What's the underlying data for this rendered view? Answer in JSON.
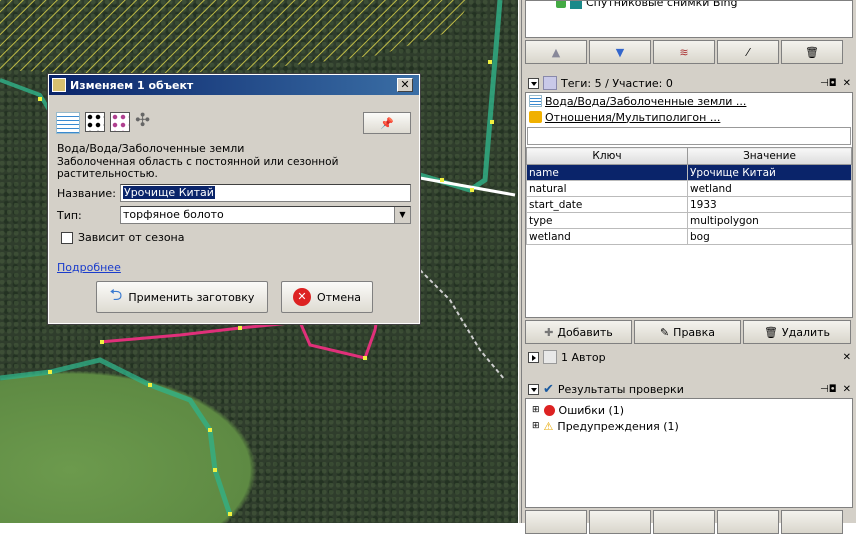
{
  "imagery": {
    "label": "Спутниковые снимки Bing"
  },
  "layer_buttons": [
    "up-arrow-icon",
    "down-arrow-icon",
    "layers-merge-icon",
    "edit-wand-icon",
    "trash-icon"
  ],
  "tags_panel": {
    "title": "Теги: 5 / Участие: 0",
    "presets": [
      "Вода/Вода/Заболоченные земли ...",
      "Отношения/Мультиполигон ..."
    ],
    "col_key": "Ключ",
    "col_value": "Значение",
    "rows": [
      {
        "key": "name",
        "value": "Урочище Китай"
      },
      {
        "key": "natural",
        "value": "wetland"
      },
      {
        "key": "start_date",
        "value": "1933"
      },
      {
        "key": "type",
        "value": "multipolygon"
      },
      {
        "key": "wetland",
        "value": "bog"
      }
    ],
    "add": "Добавить",
    "edit": "Правка",
    "delete": "Удалить"
  },
  "authors_panel": {
    "title": "1 Автор"
  },
  "validation_panel": {
    "title": "Результаты проверки",
    "errors": "Ошибки (1)",
    "warnings": "Предупреждения (1)"
  },
  "dialog": {
    "title": "Изменяем 1 объект",
    "preset_path": "Вода/Вода/Заболоченные земли",
    "description": "Заболоченная область с постоянной или сезонной растительностью.",
    "name_label": "Название:",
    "name_value": "Урочище Китай",
    "type_label": "Тип:",
    "type_value": "торфяное болото",
    "seasonal_label": "Зависит от сезона",
    "more_link": "Подробнее",
    "apply": "Применить заготовку",
    "cancel": "Отмена"
  },
  "colors": {
    "selection": "#0a246a",
    "title_bar": "#0a246a",
    "panel_bg": "#d4d0c8",
    "way_pink": "#e0307a",
    "way_green": "#2fb38a",
    "node_yellow": "#f0f040"
  }
}
